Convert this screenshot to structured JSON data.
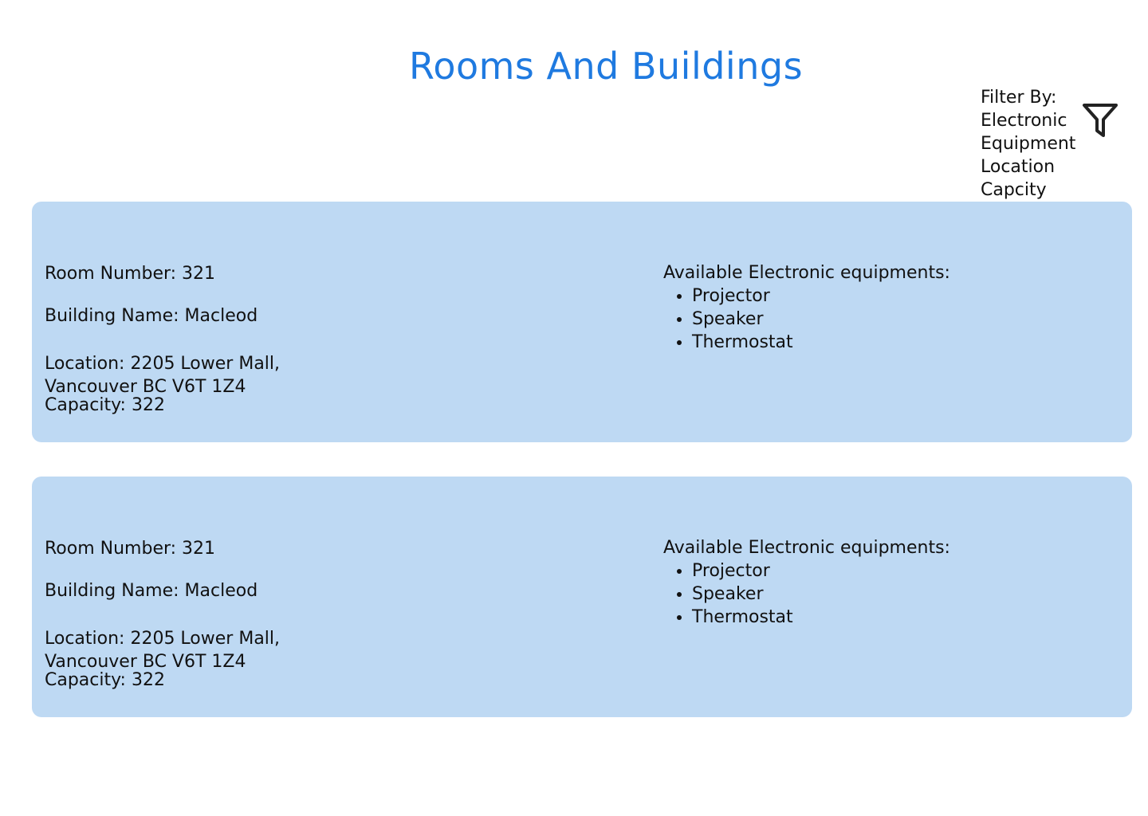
{
  "page": {
    "title": "Rooms And Buildings"
  },
  "filter": {
    "heading": "Filter By:",
    "options": [
      "Electronic",
      "Equipment",
      "Location",
      "Capcity"
    ],
    "icon": "funnel-icon"
  },
  "rooms": [
    {
      "room_number": "Room Number: 321",
      "building_name": "Building Name: Macleod",
      "location_line1": "Location: 2205 Lower Mall,",
      "location_line2": "Vancouver BC V6T 1Z4",
      "capacity": "Capacity: 322",
      "equipment_heading": "Available Electronic equipments:",
      "equipment": [
        "Projector",
        "Speaker",
        "Thermostat"
      ]
    },
    {
      "room_number": "Room Number: 321",
      "building_name": "Building Name: Macleod",
      "location_line1": "Location: 2205 Lower Mall,",
      "location_line2": "Vancouver BC V6T 1Z4",
      "capacity": "Capacity: 322",
      "equipment_heading": "Available Electronic equipments:",
      "equipment": [
        "Projector",
        "Speaker",
        "Thermostat"
      ]
    }
  ],
  "colors": {
    "title": "#1f7ae0",
    "card_background": "#bed9f3",
    "text": "#111111"
  }
}
